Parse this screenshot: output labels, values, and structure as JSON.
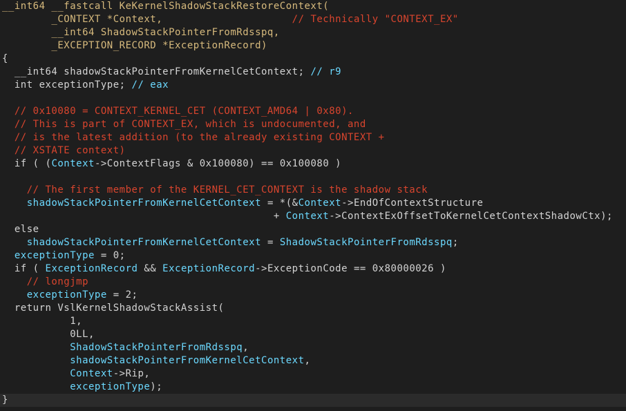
{
  "editor": {
    "language": "c-pseudocode",
    "colors": {
      "background": "#1e1e1e",
      "current_line_background": "#2b2b2b",
      "default": "#d4d4d4",
      "keyword": "#d7ba7d",
      "comment": "#d9452e",
      "variable": "#6cd9ff",
      "number": "#d4d4d4"
    },
    "lines": [
      {
        "tokens": [
          {
            "t": "__int64 __fastcall KeKernelShadowStackRestoreContext(",
            "c": "keyword"
          }
        ]
      },
      {
        "tokens": [
          {
            "t": "        _CONTEXT *Context,",
            "c": "keyword"
          },
          {
            "t": "                     // Technically \"CONTEXT_EX\"",
            "c": "comment"
          }
        ]
      },
      {
        "tokens": [
          {
            "t": "        __int64 ShadowStackPointerFromRdsspq,",
            "c": "keyword"
          }
        ]
      },
      {
        "tokens": [
          {
            "t": "        _EXCEPTION_RECORD *ExceptionRecord)",
            "c": "keyword"
          }
        ]
      },
      {
        "tokens": [
          {
            "t": "{",
            "c": "default"
          }
        ]
      },
      {
        "tokens": [
          {
            "t": "  __int64 shadowStackPointerFromKernelCetContext; ",
            "c": "default"
          },
          {
            "t": "// r9",
            "c": "variable"
          }
        ]
      },
      {
        "tokens": [
          {
            "t": "  int exceptionType; ",
            "c": "default"
          },
          {
            "t": "// eax",
            "c": "variable"
          }
        ]
      },
      {
        "tokens": [
          {
            "t": "",
            "c": "default"
          }
        ]
      },
      {
        "tokens": [
          {
            "t": "  // 0x10080 = CONTEXT_KERNEL_CET (CONTEXT_AMD64 | 0x80).",
            "c": "comment"
          }
        ]
      },
      {
        "tokens": [
          {
            "t": "  // This is part of CONTEXT_EX, which is undocumented, and",
            "c": "comment"
          }
        ]
      },
      {
        "tokens": [
          {
            "t": "  // is the latest addition (to the already existing CONTEXT +",
            "c": "comment"
          }
        ]
      },
      {
        "tokens": [
          {
            "t": "  // XSTATE context)",
            "c": "comment"
          }
        ]
      },
      {
        "tokens": [
          {
            "t": "  if ( (",
            "c": "default"
          },
          {
            "t": "Context",
            "c": "variable"
          },
          {
            "t": "->ContextFlags & 0x100080) == 0x100080 )",
            "c": "default"
          }
        ]
      },
      {
        "tokens": [
          {
            "t": "",
            "c": "default"
          }
        ]
      },
      {
        "tokens": [
          {
            "t": "    // The first member of the KERNEL_CET_CONTEXT is the shadow stack",
            "c": "comment"
          }
        ]
      },
      {
        "tokens": [
          {
            "t": "    shadowStackPointerFromKernelCetContext",
            "c": "variable"
          },
          {
            "t": " = *(&",
            "c": "default"
          },
          {
            "t": "Context",
            "c": "variable"
          },
          {
            "t": "->EndOfContextStructure",
            "c": "default"
          }
        ]
      },
      {
        "tokens": [
          {
            "t": "                                            + ",
            "c": "default"
          },
          {
            "t": "Context",
            "c": "variable"
          },
          {
            "t": "->ContextExOffsetToKernelCetContextShadowCtx);",
            "c": "default"
          }
        ]
      },
      {
        "tokens": [
          {
            "t": "  else",
            "c": "default"
          }
        ]
      },
      {
        "tokens": [
          {
            "t": "    shadowStackPointerFromKernelCetContext",
            "c": "variable"
          },
          {
            "t": " = ",
            "c": "default"
          },
          {
            "t": "ShadowStackPointerFromRdsspq",
            "c": "variable"
          },
          {
            "t": ";",
            "c": "default"
          }
        ]
      },
      {
        "tokens": [
          {
            "t": "  exceptionType",
            "c": "variable"
          },
          {
            "t": " = 0;",
            "c": "default"
          }
        ]
      },
      {
        "tokens": [
          {
            "t": "  if ( ",
            "c": "default"
          },
          {
            "t": "ExceptionRecord",
            "c": "variable"
          },
          {
            "t": " && ",
            "c": "default"
          },
          {
            "t": "ExceptionRecord",
            "c": "variable"
          },
          {
            "t": "->ExceptionCode == 0x80000026 )",
            "c": "default"
          }
        ]
      },
      {
        "tokens": [
          {
            "t": "    // longjmp",
            "c": "comment"
          }
        ]
      },
      {
        "tokens": [
          {
            "t": "    exceptionType",
            "c": "variable"
          },
          {
            "t": " = 2;",
            "c": "default"
          }
        ]
      },
      {
        "tokens": [
          {
            "t": "  return VslKernelShadowStackAssist(",
            "c": "default"
          }
        ]
      },
      {
        "tokens": [
          {
            "t": "           1,",
            "c": "default"
          }
        ]
      },
      {
        "tokens": [
          {
            "t": "           0LL,",
            "c": "default"
          }
        ]
      },
      {
        "tokens": [
          {
            "t": "           ",
            "c": "default"
          },
          {
            "t": "ShadowStackPointerFromRdsspq",
            "c": "variable"
          },
          {
            "t": ",",
            "c": "default"
          }
        ]
      },
      {
        "tokens": [
          {
            "t": "           ",
            "c": "default"
          },
          {
            "t": "shadowStackPointerFromKernelCetContext",
            "c": "variable"
          },
          {
            "t": ",",
            "c": "default"
          }
        ]
      },
      {
        "tokens": [
          {
            "t": "           ",
            "c": "default"
          },
          {
            "t": "Context",
            "c": "variable"
          },
          {
            "t": "->Rip,",
            "c": "default"
          }
        ]
      },
      {
        "tokens": [
          {
            "t": "           ",
            "c": "default"
          },
          {
            "t": "exceptionType",
            "c": "variable"
          },
          {
            "t": ");",
            "c": "default"
          }
        ]
      },
      {
        "tokens": [
          {
            "t": "}",
            "c": "default"
          }
        ],
        "current": true
      }
    ]
  }
}
